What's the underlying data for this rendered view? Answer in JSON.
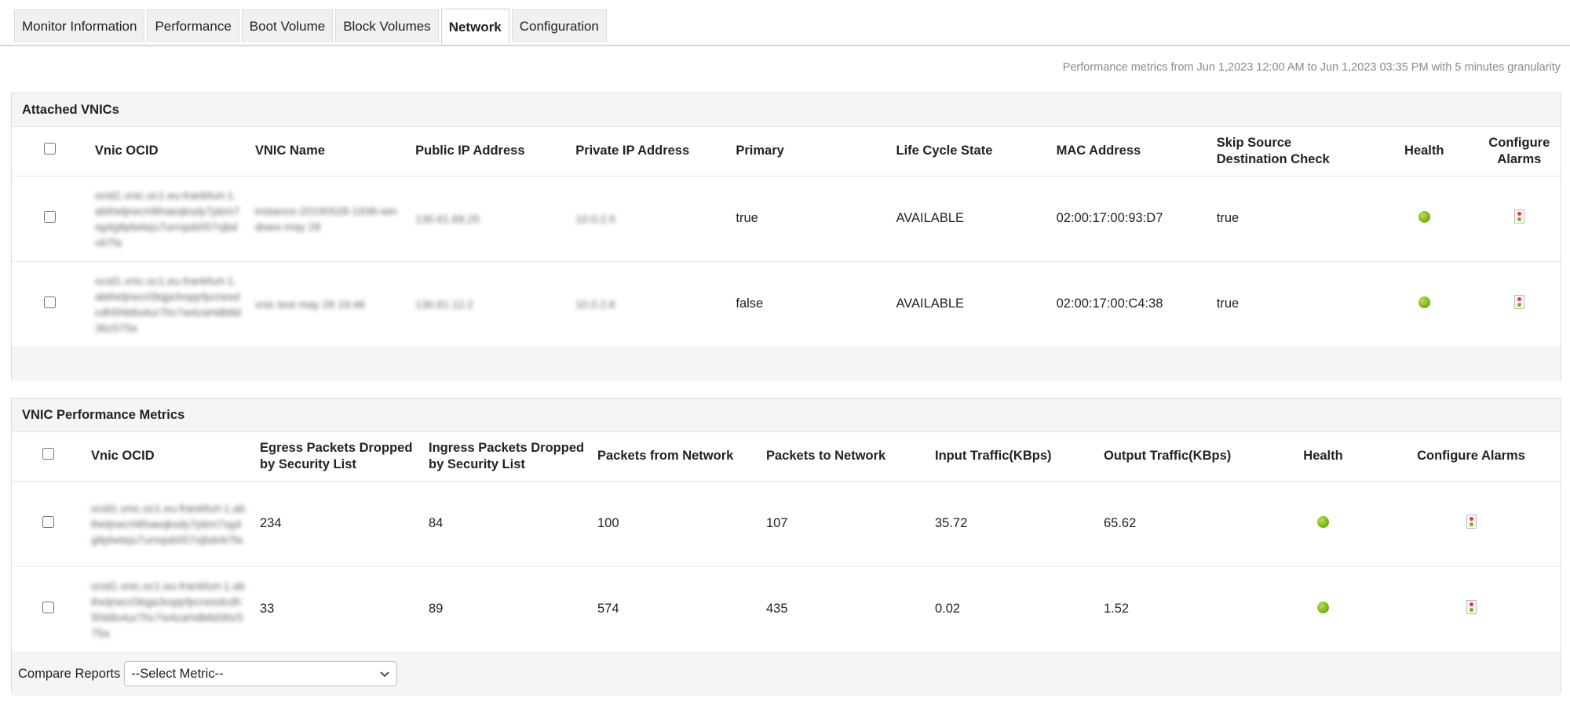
{
  "tabs": [
    {
      "label": "Monitor Information"
    },
    {
      "label": "Performance"
    },
    {
      "label": "Boot Volume"
    },
    {
      "label": "Block Volumes"
    },
    {
      "label": "Network"
    },
    {
      "label": "Configuration"
    }
  ],
  "active_tab": "Network",
  "metrics_note": "Performance metrics from Jun 1,2023 12:00 AM to Jun 1,2023 03:35 PM with 5 minutes granularity",
  "attached": {
    "title": "Attached VNICs",
    "headers": {
      "ocid": "Vnic OCID",
      "name": "VNIC Name",
      "public_ip": "Public IP Address",
      "private_ip": "Private IP Address",
      "primary": "Primary",
      "state": "Life Cycle State",
      "mac": "MAC Address",
      "skip": "Skip Source Destination Check",
      "health": "Health",
      "alarms": "Configure Alarms"
    },
    "rows": [
      {
        "ocid": "ocid1.vnic.oc1.eu-frankfurt-1.abtheljrwcrl4lhaeqksdy7pbm7sg4g8plwteju7urnqsb057xjbdvb7fa",
        "name": "instance-20190528-1938-windows-may 28",
        "public_ip": "130.61.69.25",
        "private_ip": "10.0.2.5",
        "primary": "true",
        "state": "AVAILABLE",
        "mac": "02:00:17:00:93:D7",
        "skip": "true",
        "health_color": "#7cb319"
      },
      {
        "ocid": "ocid1.vnic.oc1.eu-frankfurt-1.abtheljrwcrl3tqja3vqqrfpcrwsdcdh5hb8o4ur7hc7w4zaHdb8d36z575a",
        "name": "vnic test may 28 19:46",
        "public_ip": "130.61.12.2",
        "private_ip": "10.0.2.6",
        "primary": "false",
        "state": "AVAILABLE",
        "mac": "02:00:17:00:C4:38",
        "skip": "true",
        "health_color": "#7cb319"
      }
    ]
  },
  "perf": {
    "title": "VNIC Performance Metrics",
    "headers": {
      "ocid": "Vnic OCID",
      "egress": "Egress Packets Dropped by Security List",
      "ingress": "Ingress Packets Dropped by Security List",
      "from": "Packets from Network",
      "to": "Packets to Network",
      "input": "Input Traffic(KBps)",
      "output": "Output Traffic(KBps)",
      "health": "Health",
      "alarms": "Configure Alarms"
    },
    "rows": [
      {
        "ocid": "ocid1.vnic.oc1.eu-frankfurt-1.abtheljrwcrl4lhaeqksdy7pbm7sg4g8plwteju7urnqsb057xjbdvb7fa",
        "egress": "234",
        "ingress": "84",
        "from": "100",
        "to": "107",
        "input": "35.72",
        "output": "65.62",
        "health_color": "#7cb319"
      },
      {
        "ocid": "ocid1.vnic.oc1.eu-frankfurt-1.abtheljrwcrl3tqja3vqqrfpcrwsdcdh5hb8o4ur7hc7w4zaHdb8d36z575a",
        "egress": "33",
        "ingress": "89",
        "from": "574",
        "to": "435",
        "input": "0.02",
        "output": "1.52",
        "health_color": "#7cb319"
      }
    ]
  },
  "compare": {
    "label": "Compare Reports",
    "selected": "--Select Metric--"
  },
  "icons": {
    "health": "health-status-dot",
    "alarm": "traffic-light-alarm-icon",
    "select": "chevron-down-icon"
  }
}
